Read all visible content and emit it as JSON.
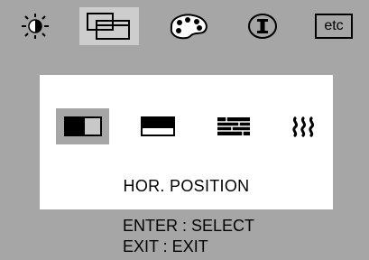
{
  "tabs": [
    {
      "name": "brightness",
      "icon": "sun-icon",
      "selected": false
    },
    {
      "name": "position",
      "icon": "position-window-icon",
      "selected": true
    },
    {
      "name": "color",
      "icon": "color-palette-icon",
      "selected": false
    },
    {
      "name": "information",
      "icon": "info-icon",
      "selected": false
    },
    {
      "name": "etc",
      "label": "etc",
      "selected": false
    }
  ],
  "sub_items": [
    {
      "icon": "hor-position-icon",
      "selected": true
    },
    {
      "icon": "ver-position-icon",
      "selected": false
    },
    {
      "icon": "phase-icon",
      "selected": false
    },
    {
      "icon": "moire-icon",
      "selected": false
    }
  ],
  "panel": {
    "label": "HOR. POSITION"
  },
  "hints": {
    "enter": "ENTER : SELECT",
    "exit": "EXIT : EXIT"
  },
  "colors": {
    "background": "#a6a6a6",
    "selected": "#cdcdcd",
    "panel": "#ffffff",
    "ink": "#000000"
  }
}
